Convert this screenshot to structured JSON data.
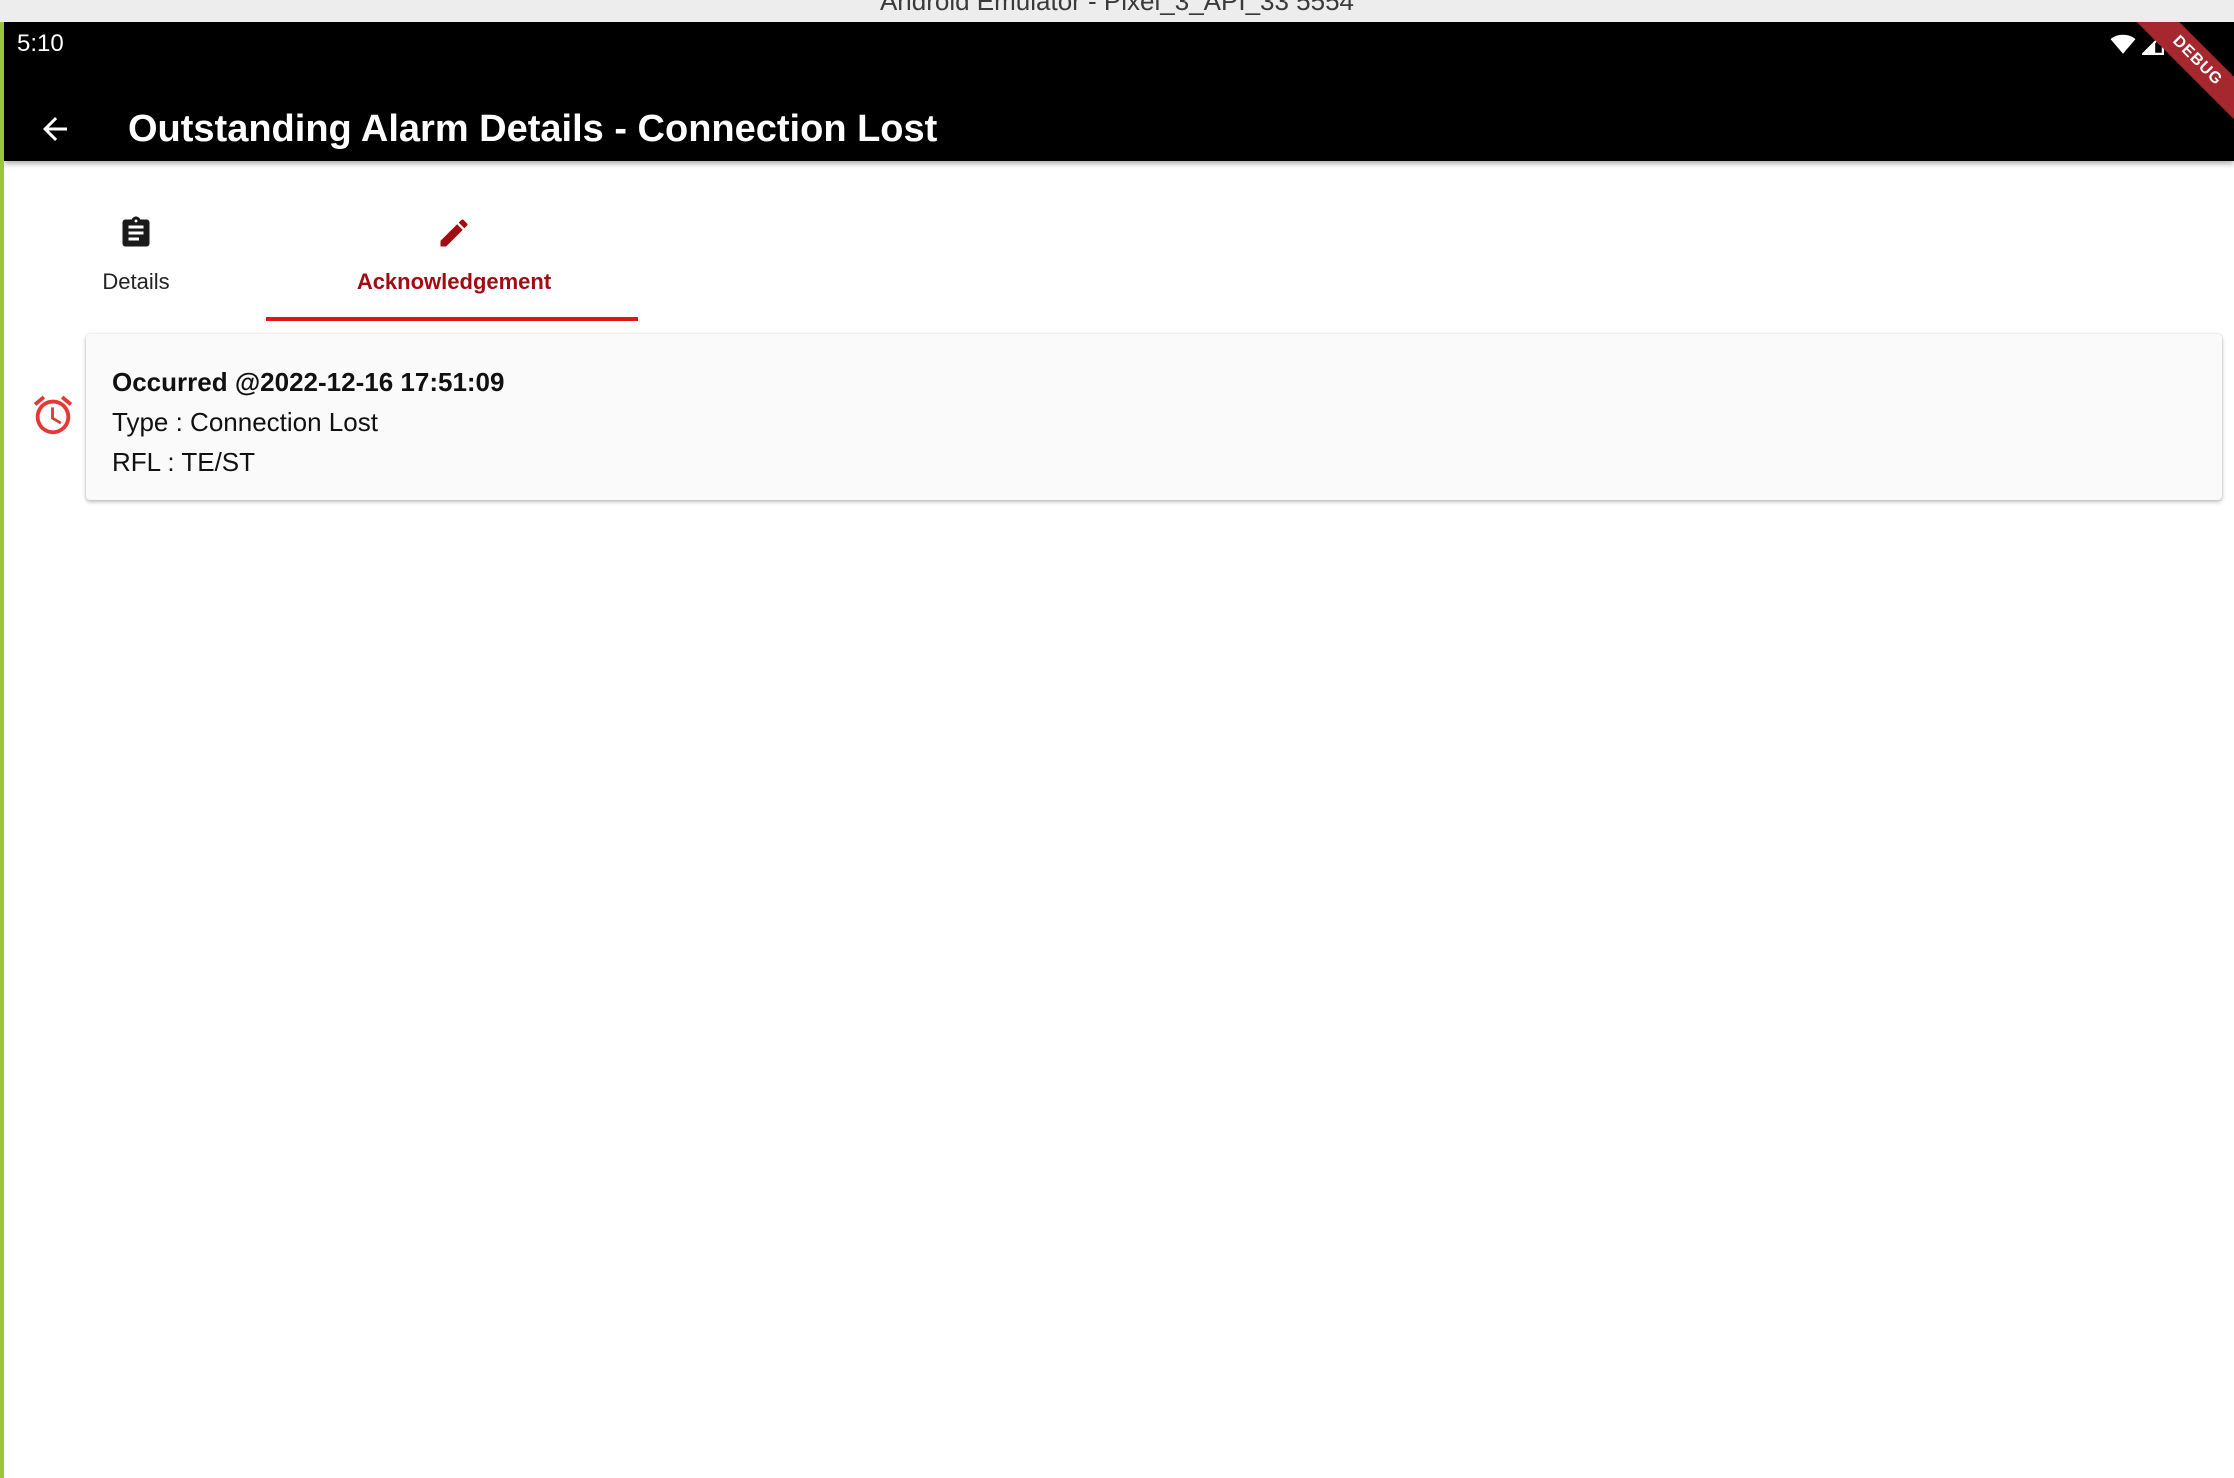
{
  "window": {
    "title": "Android Emulator - Pixel_3_API_33 5554"
  },
  "status_bar": {
    "time": "5:10",
    "icons": [
      "wifi-icon",
      "signal-icon"
    ],
    "debug_banner": "DEBUG"
  },
  "app_bar": {
    "back_icon": "arrow-back-icon",
    "title": "Outstanding Alarm Details - Connection Lost"
  },
  "tabs": [
    {
      "label": "Details",
      "icon": "clipboard-icon",
      "selected": false
    },
    {
      "label": "Acknowledgement",
      "icon": "pencil-icon",
      "selected": true
    }
  ],
  "alarm": {
    "icon": "alarm-clock-icon",
    "occurred": "Occurred @2022-12-16 17:51:09",
    "type": "Type : Connection Lost",
    "rfl": "RFL : TE/ST"
  },
  "colors": {
    "app_bar": "#000000",
    "accent": "#e0141b",
    "selected_tab_text": "#a00d12",
    "alarm_icon": "#e53935",
    "card_background": "#fafafa",
    "debug_ribbon": "#a5282f"
  }
}
